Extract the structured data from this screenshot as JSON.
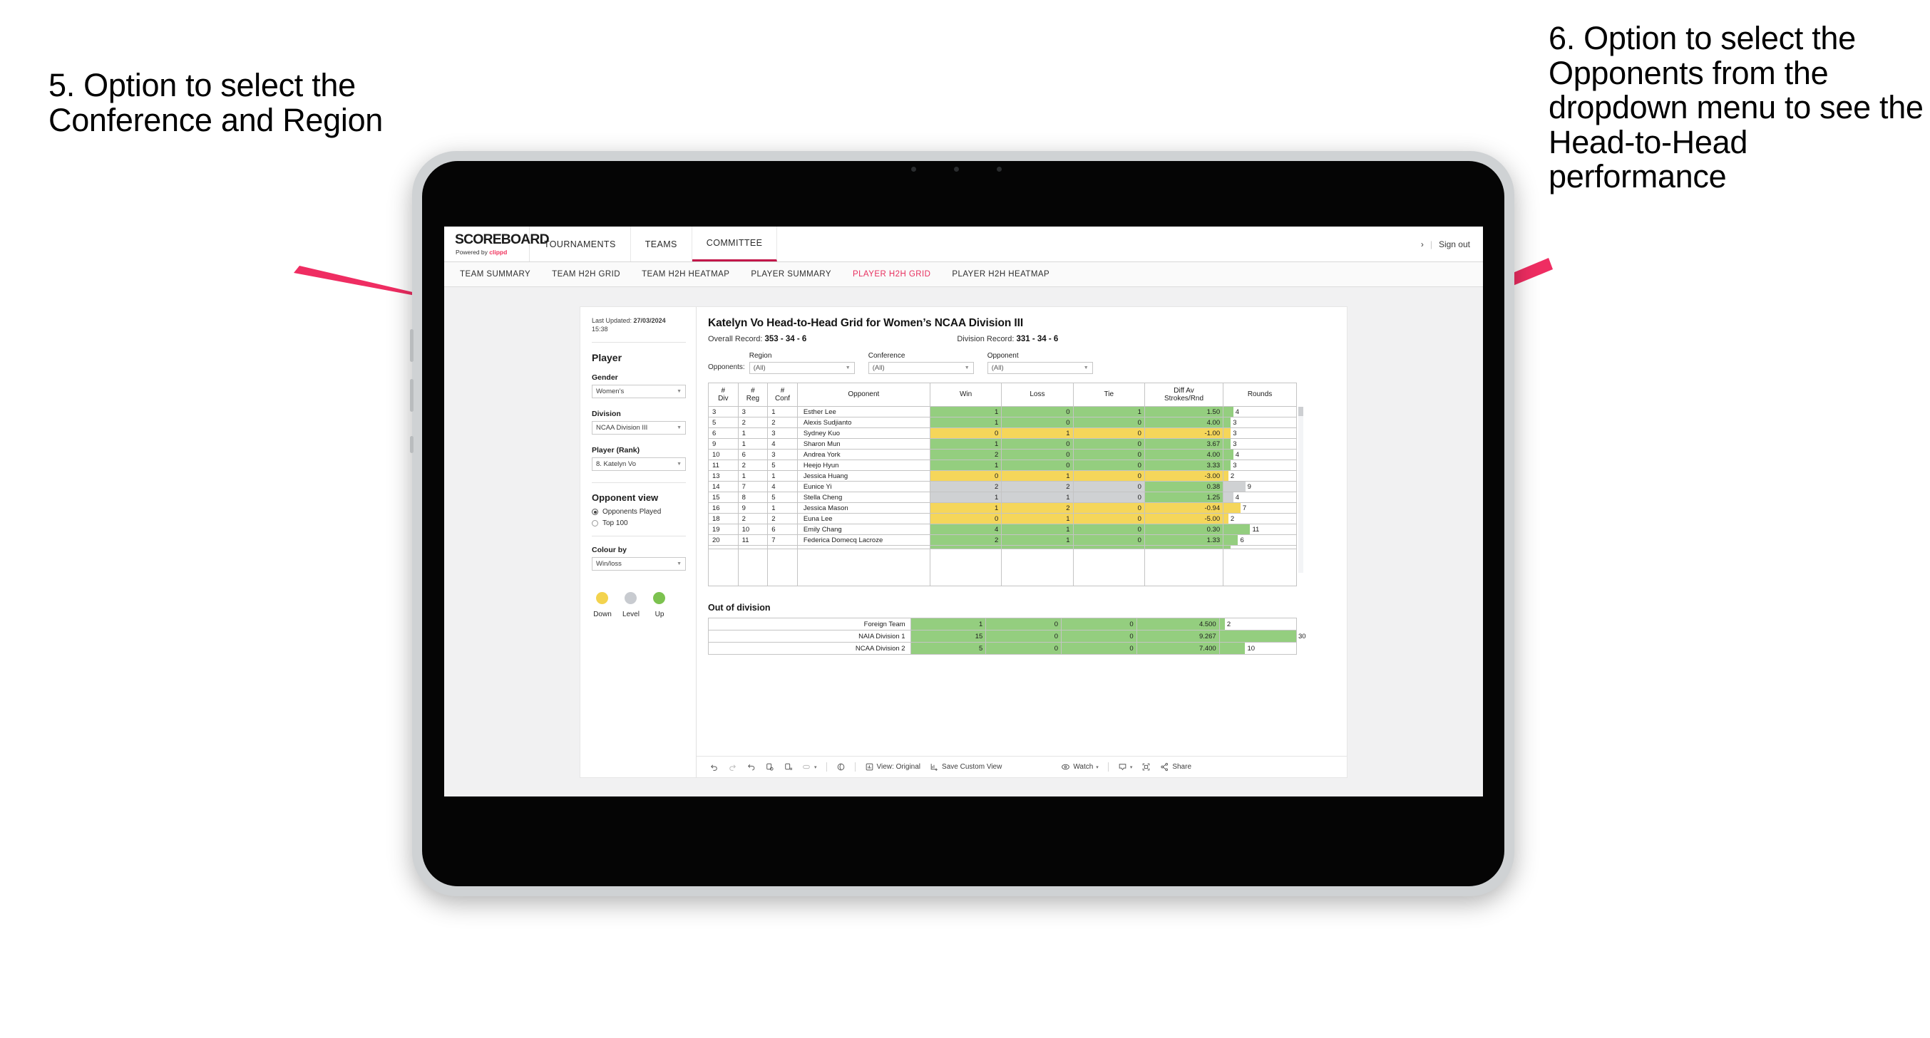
{
  "annotations": {
    "left": "5. Option to select the Conference and Region",
    "right": "6. Option to select the Opponents from the dropdown menu to see the Head-to-Head performance",
    "arrow_color": "#ef2d62"
  },
  "topnav": {
    "brand_name": "SCOREBOARD",
    "brand_sub_prefix": "Powered by ",
    "brand_sub_accent": "clippd",
    "items": [
      {
        "label": "TOURNAMENTS",
        "active": false
      },
      {
        "label": "TEAMS",
        "active": false
      },
      {
        "label": "COMMITTEE",
        "active": true
      }
    ],
    "chevron": "›",
    "separator": "|",
    "signout": "Sign out",
    "accent": "#c3174a"
  },
  "subnav": {
    "items": [
      {
        "label": "TEAM SUMMARY",
        "active": false
      },
      {
        "label": "TEAM H2H GRID",
        "active": false
      },
      {
        "label": "TEAM H2H HEATMAP",
        "active": false
      },
      {
        "label": "PLAYER SUMMARY",
        "active": false
      },
      {
        "label": "PLAYER H2H GRID",
        "active": true
      },
      {
        "label": "PLAYER H2H HEATMAP",
        "active": false
      }
    ],
    "active_color": "#e8305f"
  },
  "sidebar": {
    "last_updated_label": "Last Updated: ",
    "last_updated_value": "27/03/2024",
    "last_updated_time": "15:38",
    "title": "Player",
    "fields": [
      {
        "label": "Gender",
        "value": "Women’s"
      },
      {
        "label": "Division",
        "value": "NCAA Division III"
      },
      {
        "label": "Player (Rank)",
        "value": "8. Katelyn Vo"
      }
    ],
    "opponent_view": {
      "title": "Opponent view",
      "options": [
        {
          "label": "Opponents Played",
          "selected": true
        },
        {
          "label": "Top 100",
          "selected": false
        }
      ]
    },
    "colour_by": {
      "label": "Colour by",
      "value": "Win/loss"
    },
    "legend": [
      {
        "label": "Down",
        "color": "#f3d34e"
      },
      {
        "label": "Level",
        "color": "#c8cbd0"
      },
      {
        "label": "Up",
        "color": "#7cc24f"
      }
    ]
  },
  "main": {
    "title": "Katelyn Vo Head-to-Head Grid for Women’s NCAA Division III",
    "overall_record_label": "Overall Record: ",
    "overall_record_value": "353 - 34 - 6",
    "division_record_label": "Division Record: ",
    "division_record_value": "331 - 34 - 6",
    "filters_prefix": "Opponents:",
    "filters": [
      {
        "label": "Region",
        "value": "(All)"
      },
      {
        "label": "Conference",
        "value": "(All)"
      },
      {
        "label": "Opponent",
        "value": "(All)"
      }
    ],
    "out_of_division_title": "Out of division"
  },
  "chart_data": {
    "type": "table",
    "title": "Katelyn Vo Head-to-Head Grid for Women’s NCAA Division III",
    "columns": [
      "# Div",
      "# Reg",
      "# Conf",
      "Opponent",
      "Win",
      "Loss",
      "Tie",
      "Diff Av Strokes/Rnd",
      "Rounds"
    ],
    "column_headers_multiline": [
      [
        "#",
        "Div"
      ],
      [
        "#",
        "Reg"
      ],
      [
        "#",
        "Conf"
      ],
      [
        "Opponent"
      ],
      [
        "Win"
      ],
      [
        "Loss"
      ],
      [
        "Tie"
      ],
      [
        "Diff Av",
        "Strokes/Rnd"
      ],
      [
        "Rounds"
      ]
    ],
    "colors": {
      "up": "#94ce7f",
      "down": "#f5d65a",
      "level": "#cfd1d3",
      "bar_max_rounds": 30
    },
    "rows": [
      {
        "div": "3",
        "reg": "3",
        "conf": "1",
        "opponent": "Esther Lee",
        "win": "1",
        "loss": "0",
        "tie": "1",
        "diff": "1.50",
        "rounds": 4,
        "state": "up"
      },
      {
        "div": "5",
        "reg": "2",
        "conf": "2",
        "opponent": "Alexis Sudjianto",
        "win": "1",
        "loss": "0",
        "tie": "0",
        "diff": "4.00",
        "rounds": 3,
        "state": "up"
      },
      {
        "div": "6",
        "reg": "1",
        "conf": "3",
        "opponent": "Sydney Kuo",
        "win": "0",
        "loss": "1",
        "tie": "0",
        "diff": "-1.00",
        "rounds": 3,
        "state": "down"
      },
      {
        "div": "9",
        "reg": "1",
        "conf": "4",
        "opponent": "Sharon Mun",
        "win": "1",
        "loss": "0",
        "tie": "0",
        "diff": "3.67",
        "rounds": 3,
        "state": "up"
      },
      {
        "div": "10",
        "reg": "6",
        "conf": "3",
        "opponent": "Andrea York",
        "win": "2",
        "loss": "0",
        "tie": "0",
        "diff": "4.00",
        "rounds": 4,
        "state": "up"
      },
      {
        "div": "11",
        "reg": "2",
        "conf": "5",
        "opponent": "Heejo Hyun",
        "win": "1",
        "loss": "0",
        "tie": "0",
        "diff": "3.33",
        "rounds": 3,
        "state": "up"
      },
      {
        "div": "13",
        "reg": "1",
        "conf": "1",
        "opponent": "Jessica Huang",
        "win": "0",
        "loss": "1",
        "tie": "0",
        "diff": "-3.00",
        "rounds": 2,
        "state": "down"
      },
      {
        "div": "14",
        "reg": "7",
        "conf": "4",
        "opponent": "Eunice Yi",
        "win": "2",
        "loss": "2",
        "tie": "0",
        "diff": "0.38",
        "rounds": 9,
        "state": "level",
        "diff_state": "up"
      },
      {
        "div": "15",
        "reg": "8",
        "conf": "5",
        "opponent": "Stella Cheng",
        "win": "1",
        "loss": "1",
        "tie": "0",
        "diff": "1.25",
        "rounds": 4,
        "state": "level",
        "diff_state": "up"
      },
      {
        "div": "16",
        "reg": "9",
        "conf": "1",
        "opponent": "Jessica Mason",
        "win": "1",
        "loss": "2",
        "tie": "0",
        "diff": "-0.94",
        "rounds": 7,
        "state": "down"
      },
      {
        "div": "18",
        "reg": "2",
        "conf": "2",
        "opponent": "Euna Lee",
        "win": "0",
        "loss": "1",
        "tie": "0",
        "diff": "-5.00",
        "rounds": 2,
        "state": "down"
      },
      {
        "div": "19",
        "reg": "10",
        "conf": "6",
        "opponent": "Emily Chang",
        "win": "4",
        "loss": "1",
        "tie": "0",
        "diff": "0.30",
        "rounds": 11,
        "state": "up"
      },
      {
        "div": "20",
        "reg": "11",
        "conf": "7",
        "opponent": "Federica Domecq Lacroze",
        "win": "2",
        "loss": "1",
        "tie": "0",
        "diff": "1.33",
        "rounds": 6,
        "state": "up"
      }
    ],
    "out_of_division_rows": [
      {
        "name": "Foreign Team",
        "win": "1",
        "loss": "0",
        "tie": "0",
        "diff": "4.500",
        "rounds": 2,
        "state": "up"
      },
      {
        "name": "NAIA Division 1",
        "win": "15",
        "loss": "0",
        "tie": "0",
        "diff": "9.267",
        "rounds": 30,
        "state": "up"
      },
      {
        "name": "NCAA Division 2",
        "win": "5",
        "loss": "0",
        "tie": "0",
        "diff": "7.400",
        "rounds": 10,
        "state": "up"
      }
    ]
  },
  "toolbar": {
    "view_label": "View: Original",
    "save_label": "Save Custom View",
    "watch_label": "Watch",
    "share_label": "Share",
    "caret": "▾"
  }
}
